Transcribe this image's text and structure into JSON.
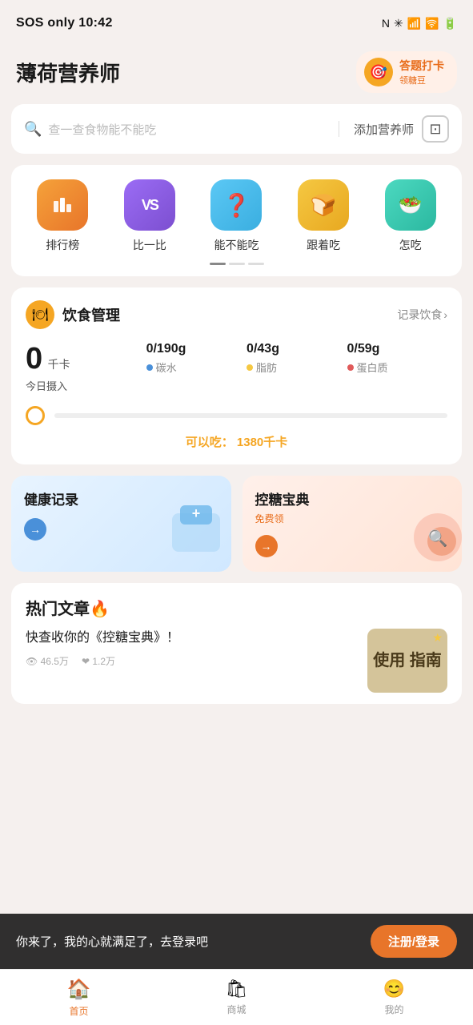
{
  "status": {
    "carrier": "SOS only",
    "time": "10:42",
    "icons": [
      "NFC",
      "BT",
      "signal",
      "wifi",
      "battery"
    ]
  },
  "header": {
    "title": "薄荷营养师",
    "quiz_badge": {
      "label": "答题打卡",
      "sub": "领糖豆"
    }
  },
  "search": {
    "placeholder": "查一查食物能不能吃",
    "add_nutritionist": "添加营养师"
  },
  "categories": [
    {
      "id": "ranking",
      "icon": "🏆",
      "label": "排行榜",
      "color": "cat-orange"
    },
    {
      "id": "compare",
      "icon": "VS",
      "label": "比一比",
      "color": "cat-purple"
    },
    {
      "id": "can-eat",
      "icon": "❓",
      "label": "能不能吃",
      "color": "cat-blue"
    },
    {
      "id": "follow-eat",
      "icon": "🍞",
      "label": "跟着吃",
      "color": "cat-yellow"
    },
    {
      "id": "how-eat",
      "icon": "🥗",
      "label": "怎吃",
      "color": "cat-teal"
    }
  ],
  "diet": {
    "title": "饮食管理",
    "link": "记录饮食",
    "calories_consumed": "0",
    "calories_unit": "千卡",
    "calories_label": "今日摄入",
    "carbs": "0/190g",
    "carbs_label": "碳水",
    "fat": "0/43g",
    "fat_label": "脂肪",
    "protein": "0/59g",
    "protein_label": "蛋白质",
    "can_eat_label": "可以吃：",
    "can_eat_value": "1380千卡"
  },
  "cards": [
    {
      "id": "health-record",
      "title": "健康记录",
      "color": "health",
      "arrow": "→"
    },
    {
      "id": "sugar-control",
      "title": "控糖宝典",
      "sub": "免费领",
      "color": "sugar",
      "arrow": "→"
    }
  ],
  "articles": {
    "section_title": "热门文章🔥",
    "items": [
      {
        "text": "快查收你的《控糖宝典》！",
        "thumb_text": "使用\n指南",
        "views": "46.5万",
        "likes": "1.2万"
      }
    ]
  },
  "login_bar": {
    "text": "你来了，我的心就满足了，去登录吧",
    "button": "注册/登录"
  },
  "tabs": [
    {
      "id": "home",
      "icon": "🏠",
      "label": "首页",
      "active": true
    },
    {
      "id": "shop",
      "icon": "🛍",
      "label": "商城",
      "active": false
    },
    {
      "id": "mine",
      "icon": "😊",
      "label": "我的",
      "active": false
    }
  ]
}
